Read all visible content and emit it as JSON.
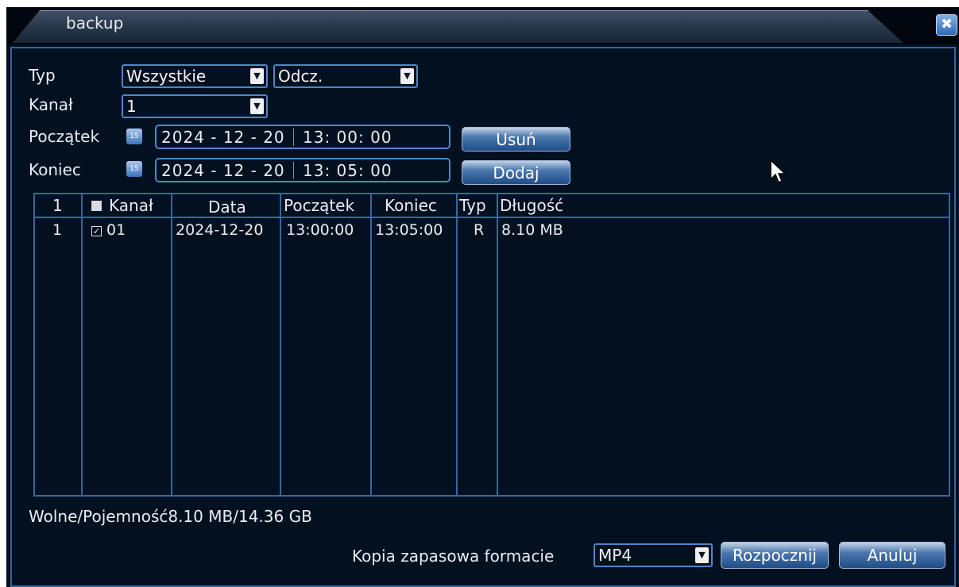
{
  "window": {
    "title": "backup",
    "close_glyph": "✖"
  },
  "filters": {
    "typ_label": "Typ",
    "typ_value": "Wszystkie",
    "mode_value": "Odcz.",
    "kanal_label": "Kanał",
    "kanal_value": "1",
    "start_label": "Początek",
    "start_date": "2024 - 12 - 20",
    "start_time": "13: 00: 00",
    "end_label": "Koniec",
    "end_date": "2024 - 12 - 20",
    "end_time": "13: 05: 00",
    "calendar_icon_text": "15",
    "delete_button": "Usuń",
    "add_button": "Dodaj"
  },
  "table": {
    "columns": [
      "1",
      "Kanał",
      "Data",
      "Początek",
      "Koniec",
      "Typ",
      "Długość"
    ],
    "rows": [
      {
        "index": "1",
        "checked": true,
        "channel": "01",
        "date": "2024-12-20",
        "start": "13:00:00",
        "end": "13:05:00",
        "type": "R",
        "length": "8.10 MB"
      }
    ]
  },
  "footer": {
    "capacity": "Wolne/Pojemność8.10 MB/14.36 GB",
    "format_label": "Kopia zapasowa formacie",
    "format_value": "MP4",
    "start_button": "Rozpocznij",
    "cancel_button": "Anuluj"
  },
  "colors": {
    "background": "#03101f",
    "border": "#35679f",
    "accent": "#4d86c6"
  }
}
